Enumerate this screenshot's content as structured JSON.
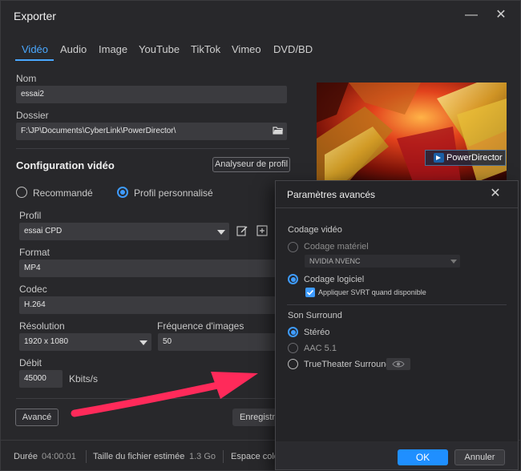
{
  "window": {
    "title": "Exporter",
    "minimize": "—",
    "close": "✕"
  },
  "tabs": [
    "Vidéo",
    "Audio",
    "Image",
    "YouTube",
    "TikTok",
    "Vimeo",
    "DVD/BD"
  ],
  "name": {
    "label": "Nom",
    "value": "essai2"
  },
  "folder": {
    "label": "Dossier",
    "value": "F:\\JP\\Documents\\CyberLink\\PowerDirector\\"
  },
  "config": {
    "title": "Configuration vidéo",
    "analyzer_button": "Analyseur de profil",
    "recommended": "Recommandé",
    "custom": "Profil personnalisé"
  },
  "profile": {
    "label": "Profil",
    "value": "essai CPD"
  },
  "format": {
    "label": "Format",
    "value": "MP4"
  },
  "codec": {
    "label": "Codec",
    "value": "H.264"
  },
  "resolution": {
    "label": "Résolution",
    "value": "1920 x 1080"
  },
  "framerate": {
    "label": "Fréquence d'images",
    "value": "50"
  },
  "bitrate": {
    "label": "Débit",
    "value": "45000",
    "unit": "Kbits/s"
  },
  "buttons": {
    "advanced": "Avancé",
    "save": "Enregistre"
  },
  "preview": {
    "badge": "PowerDirector"
  },
  "status": {
    "duration_label": "Durée",
    "duration_value": "04:00:01",
    "size_label": "Taille du fichier estimée",
    "size_value": "1.3 Go",
    "space_label": "Espace colo"
  },
  "advanced_panel": {
    "title": "Paramètres avancés",
    "video_coding": "Codage vidéo",
    "hardware": "Codage matériel",
    "hardware_device": "NVIDIA NVENC",
    "software": "Codage logiciel",
    "svrt": "Appliquer SVRT quand disponible",
    "surround": "Son Surround",
    "stereo": "Stéréo",
    "aac": "AAC 5.1",
    "truetheater": "TrueTheater Surround",
    "ok": "OK",
    "cancel": "Annuler"
  },
  "colors": {
    "accent": "#3e9bff",
    "arrow": "#ff2a5a"
  }
}
